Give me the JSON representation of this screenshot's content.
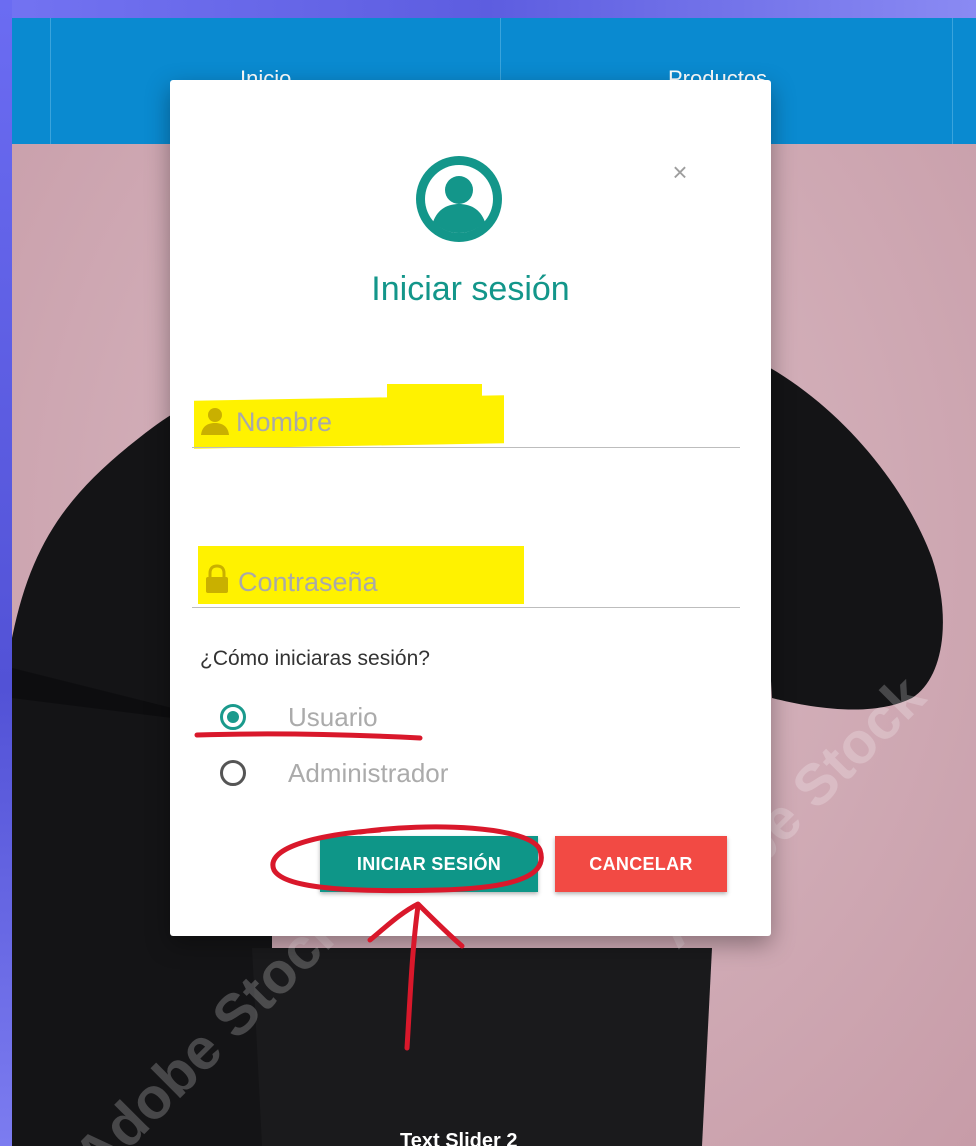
{
  "navbar": {
    "items": [
      {
        "label": "Inicio"
      },
      {
        "label": "Productos"
      }
    ]
  },
  "hero": {
    "slider_text": "Text Slider 2",
    "watermark": "Adobe Stock"
  },
  "modal": {
    "title": "Iniciar sesión",
    "close_label": "×",
    "username": {
      "placeholder": "Nombre",
      "value": ""
    },
    "password": {
      "placeholder": "Contraseña",
      "value": ""
    },
    "question": "¿Cómo iniciaras sesión?",
    "options": [
      {
        "label": "Usuario",
        "selected": true
      },
      {
        "label": "Administrador",
        "selected": false
      }
    ],
    "submit_label": "INICIAR SESIÓN",
    "cancel_label": "CANCELAR"
  },
  "colors": {
    "accent": "#13968a",
    "navbar": "#0a8ad0",
    "cancel": "#f24a44",
    "highlight": "#fff200",
    "annotation": "#d9182b"
  },
  "icons": {
    "avatar": "account-circle-icon",
    "user": "person-icon",
    "password": "lock-icon"
  }
}
